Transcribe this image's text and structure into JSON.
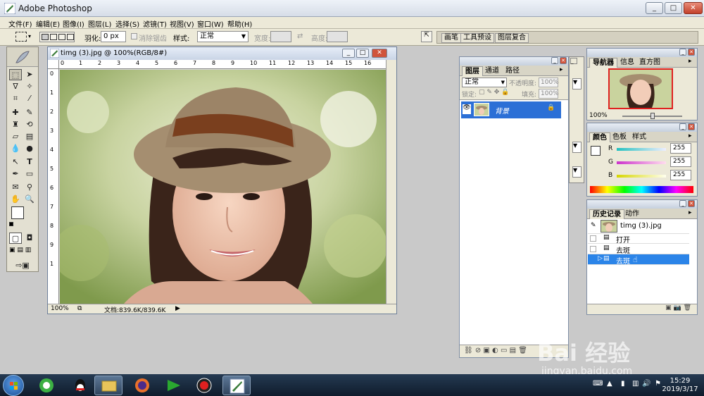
{
  "window": {
    "title": "Adobe Photoshop",
    "controls": [
      "_",
      "□",
      "✕"
    ]
  },
  "menu": {
    "items": [
      "文件(F)",
      "编辑(E)",
      "图像(I)",
      "图层(L)",
      "选择(S)",
      "滤镜(T)",
      "视图(V)",
      "窗口(W)",
      "帮助(H)"
    ]
  },
  "options": {
    "feather_label": "羽化:",
    "feather_value": "0 px",
    "antialias_label": "消除锯齿",
    "style_label": "样式:",
    "style_value": "正常",
    "width_label": "宽度:",
    "height_label": "高度:",
    "palette_tabs": [
      "画笔",
      "工具预设",
      "图层复合"
    ]
  },
  "document": {
    "title": "timg (3).jpg @ 100%(RGB/8#)",
    "ruler_h": [
      "0",
      "1",
      "2",
      "3",
      "4",
      "5",
      "6",
      "7",
      "8",
      "9",
      "10",
      "11",
      "12",
      "13",
      "14",
      "15",
      "16"
    ],
    "ruler_v": [
      "0",
      "1",
      "2",
      "3",
      "4",
      "5",
      "6",
      "7",
      "8",
      "9",
      "1"
    ],
    "zoom": "100%",
    "doc_info": "文档:839.6K/839.6K"
  },
  "layers_panel": {
    "tabs": [
      "图层",
      "通道",
      "路径"
    ],
    "blend_mode": "正常",
    "opacity_label": "不透明度:",
    "opacity_value": "100%",
    "lock_label": "锁定:",
    "fill_label": "填充:",
    "fill_value": "100%",
    "layer_name": "背景"
  },
  "navigator_panel": {
    "tabs": [
      "导航器",
      "信息",
      "直方图"
    ],
    "zoom": "100%"
  },
  "color_panel": {
    "tabs": [
      "颜色",
      "色板",
      "样式"
    ],
    "channels": [
      {
        "label": "R",
        "value": "255",
        "color": "#22b8b8"
      },
      {
        "label": "G",
        "value": "255",
        "color": "#cc33cc"
      },
      {
        "label": "B",
        "value": "255",
        "color": "#d6d600"
      }
    ]
  },
  "history_panel": {
    "tabs": [
      "历史记录",
      "动作"
    ],
    "snapshot": "timg (3).jpg",
    "steps": [
      "打开",
      "去斑",
      "去斑"
    ],
    "selected_index": 2
  },
  "taskbar": {
    "time": "15:29",
    "date": "2019/3/17"
  },
  "watermark": {
    "logo": "Bai 经验",
    "url": "jingyan.baidu.com"
  },
  "colors": {
    "selection_blue": "#2b6fd6",
    "history_selected": "#2b84e8",
    "taskbar": "#1a2a3e"
  }
}
